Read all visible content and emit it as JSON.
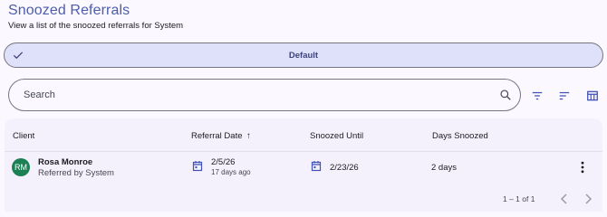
{
  "header": {
    "title": "Snoozed Referrals",
    "subtitle": "View a list of the snoozed referrals for System"
  },
  "view": {
    "selected_label": "Default"
  },
  "search": {
    "placeholder": "Search"
  },
  "toolbar": {
    "icons": [
      "filter-icon",
      "sort-icon",
      "columns-icon"
    ]
  },
  "table": {
    "columns": {
      "client": "Client",
      "referral_date": "Referral Date",
      "snoozed_until": "Snoozed Until",
      "days_snoozed": "Days Snoozed"
    },
    "sort_indicator": "↑",
    "rows": [
      {
        "initials": "RM",
        "client_name": "Rosa Monroe",
        "referred_by": "Referred by System",
        "referral_date": "2/5/26",
        "referral_ago": "17 days ago",
        "snoozed_until": "2/23/26",
        "days_snoozed": "2 days"
      }
    ]
  },
  "pagination": {
    "range_text": "1 – 1 of 1"
  },
  "colors": {
    "title": "#4d5dab",
    "chip_bg": "#dfe1fa",
    "avatar_bg": "#1d7f54",
    "icon_blue": "#3f51b5"
  }
}
